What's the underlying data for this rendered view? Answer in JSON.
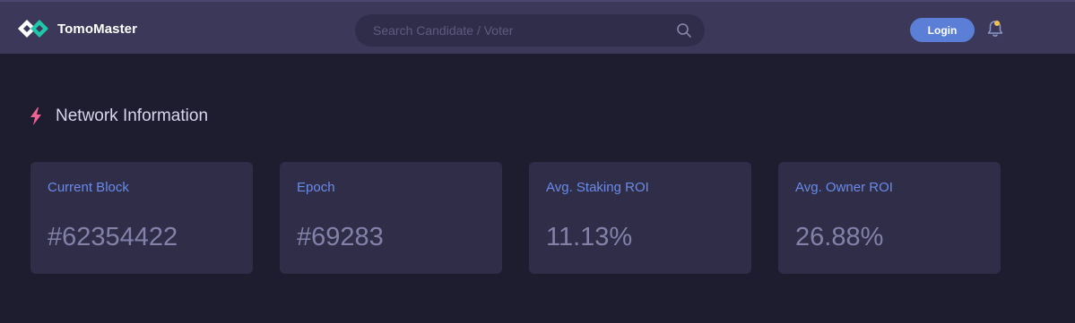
{
  "brand": {
    "name": "TomoMaster",
    "icon": "tomomaster-logo-icon",
    "colors": {
      "left": "#ffffff",
      "right": "#20c7a8"
    }
  },
  "search": {
    "placeholder": "Search Candidate / Voter",
    "value": "",
    "icon": "search-icon"
  },
  "header": {
    "login_label": "Login",
    "notification_icon": "bell-icon",
    "notification_indicator_color": "#f2c14e"
  },
  "section": {
    "title": "Network Information",
    "icon": "lightning-bolt-icon",
    "icon_color": "#f06292"
  },
  "cards": [
    {
      "label": "Current Block",
      "value": "#62354422"
    },
    {
      "label": "Epoch",
      "value": "#69283"
    },
    {
      "label": "Avg. Staking ROI",
      "value": "11.13%"
    },
    {
      "label": "Avg. Owner ROI",
      "value": "26.88%"
    }
  ],
  "colors": {
    "page_background": "#1e1d30",
    "navbar": "#3b3859",
    "card": "#2f2d48",
    "accent": "#5b7fd6",
    "card_label": "#6a8be8",
    "card_value": "#8381a8"
  }
}
